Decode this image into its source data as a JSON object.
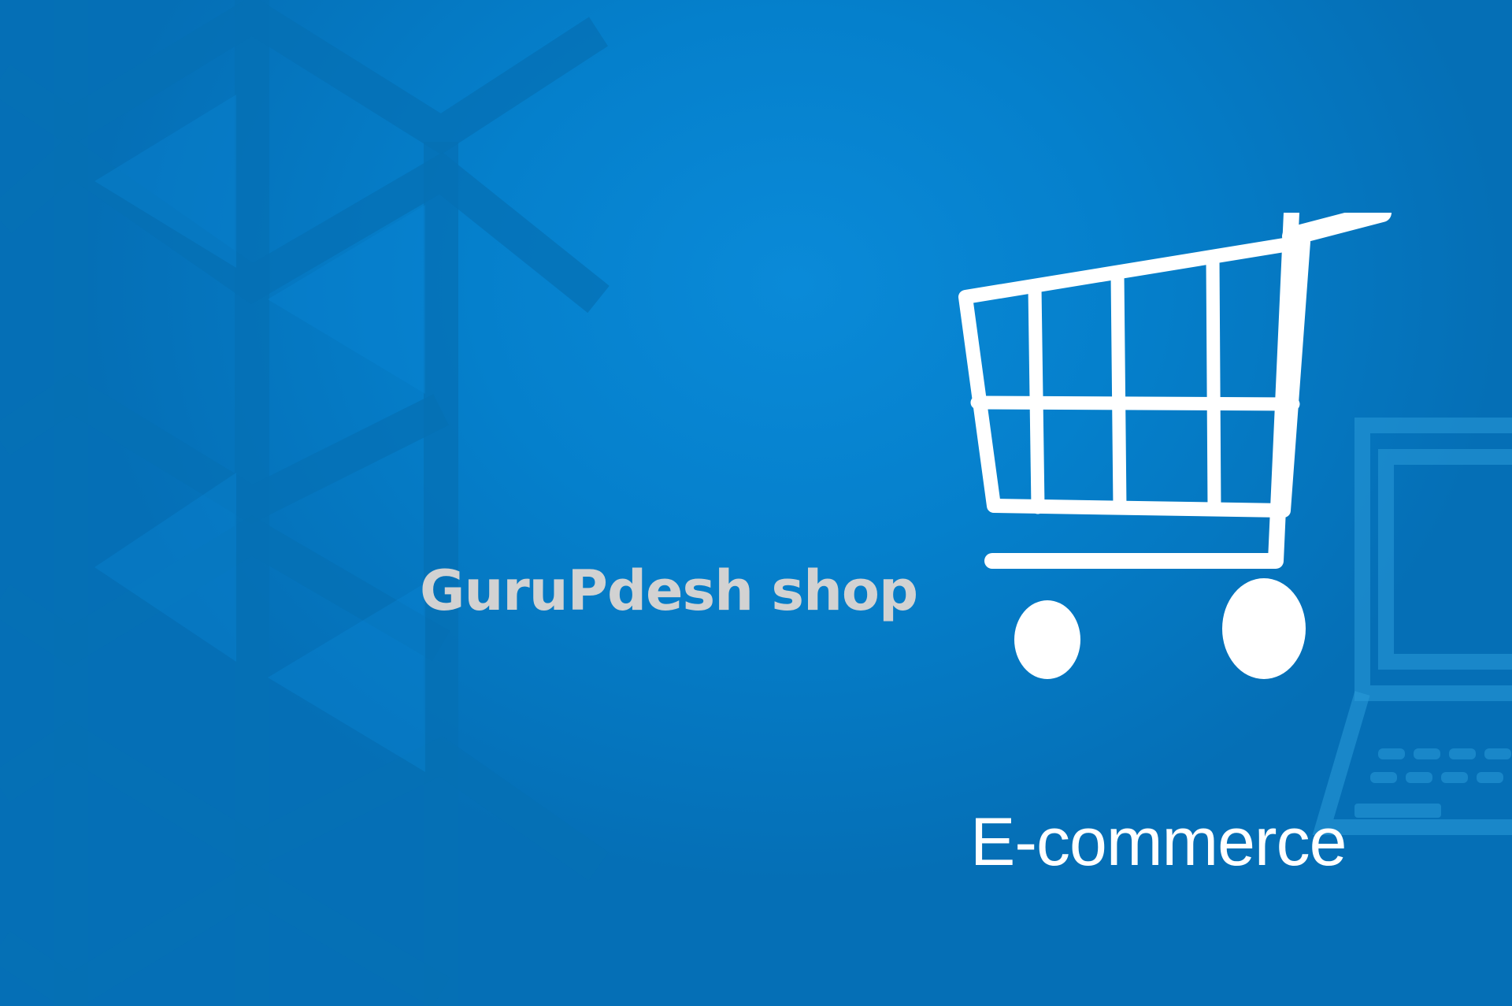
{
  "banner": {
    "shop_name": "GuruPdesh shop",
    "category_label": "E-commerce",
    "icons": {
      "cart": "shopping-cart-icon",
      "laptop": "laptop-icon"
    },
    "colors": {
      "background": "#0580cc",
      "background_center": "#0a8ad8",
      "pattern": "#0570b4",
      "shop_name": "#d2d2d2",
      "category_label": "#ffffff",
      "cart": "#ffffff"
    }
  }
}
